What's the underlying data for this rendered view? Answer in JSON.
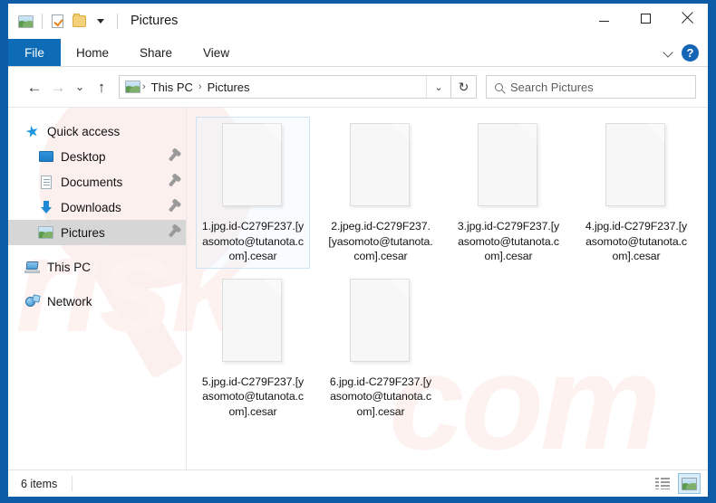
{
  "window": {
    "title": "Pictures",
    "quick_access_toolbar": [
      {
        "name": "pictures-folder-icon",
        "icon": "picture-icon"
      },
      {
        "name": "properties-icon",
        "icon": "properties-checkbox-icon"
      },
      {
        "name": "new-folder-icon",
        "icon": "folder-icon"
      },
      {
        "name": "customize-qat-icon",
        "icon": "chevron-down-icon"
      }
    ],
    "controls": {
      "minimize": "–",
      "maximize": "☐",
      "close": "✕"
    }
  },
  "ribbon": {
    "tabs": [
      {
        "label": "File",
        "active": true
      },
      {
        "label": "Home",
        "active": false
      },
      {
        "label": "Share",
        "active": false
      },
      {
        "label": "View",
        "active": false
      }
    ],
    "collapse_icon": "chevron-down-icon",
    "help_label": "?"
  },
  "navigation": {
    "back": "←",
    "forward": "→",
    "recent": "⌄",
    "up": "↑",
    "refresh": "↻",
    "dropdown": "⌄",
    "breadcrumb": {
      "icon": "picture-icon",
      "items": [
        "This PC",
        "Pictures"
      ],
      "separator": "›"
    }
  },
  "search": {
    "placeholder": "Search Pictures",
    "icon": "search-icon"
  },
  "sidebar": {
    "items": [
      {
        "label": "Quick access",
        "icon": "star-icon",
        "level": 0,
        "pinned": false,
        "selected": false
      },
      {
        "label": "Desktop",
        "icon": "desktop-icon",
        "level": 1,
        "pinned": true,
        "selected": false
      },
      {
        "label": "Documents",
        "icon": "document-icon",
        "level": 1,
        "pinned": true,
        "selected": false
      },
      {
        "label": "Downloads",
        "icon": "download-icon",
        "level": 1,
        "pinned": true,
        "selected": false
      },
      {
        "label": "Pictures",
        "icon": "picture-icon",
        "level": 1,
        "pinned": true,
        "selected": true
      },
      {
        "label": "This PC",
        "icon": "computer-icon",
        "level": 0,
        "pinned": false,
        "selected": false
      },
      {
        "label": "Network",
        "icon": "network-icon",
        "level": 0,
        "pinned": false,
        "selected": false
      }
    ]
  },
  "files": [
    {
      "name": "1.jpg.id-C279F237.[yasomoto@tutanota.com].cesar",
      "icon": "generic-file-icon",
      "selected": true
    },
    {
      "name": "2.jpeg.id-C279F237.[yasomoto@tutanota.com].cesar",
      "icon": "generic-file-icon",
      "selected": false
    },
    {
      "name": "3.jpg.id-C279F237.[yasomoto@tutanota.com].cesar",
      "icon": "generic-file-icon",
      "selected": false
    },
    {
      "name": "4.jpg.id-C279F237.[yasomoto@tutanota.com].cesar",
      "icon": "generic-file-icon",
      "selected": false
    },
    {
      "name": "5.jpg.id-C279F237.[yasomoto@tutanota.com].cesar",
      "icon": "generic-file-icon",
      "selected": false
    },
    {
      "name": "6.jpg.id-C279F237.[yasomoto@tutanota.com].cesar",
      "icon": "generic-file-icon",
      "selected": false
    }
  ],
  "status": {
    "item_count_label": "6 items",
    "views": [
      {
        "name": "details-view",
        "icon": "details-view-icon",
        "active": false
      },
      {
        "name": "large-icons-view",
        "icon": "large-icons-view-icon",
        "active": true
      }
    ]
  },
  "watermark": {
    "text": "risk",
    "text2": "com"
  },
  "colors": {
    "desktop_blue": "#0d5ca8",
    "file_tab_blue": "#0d6cb5",
    "selection_border": "#cfe3f5",
    "sidebar_selected": "#d6d6d6",
    "view_active": "#d8ecf8"
  }
}
